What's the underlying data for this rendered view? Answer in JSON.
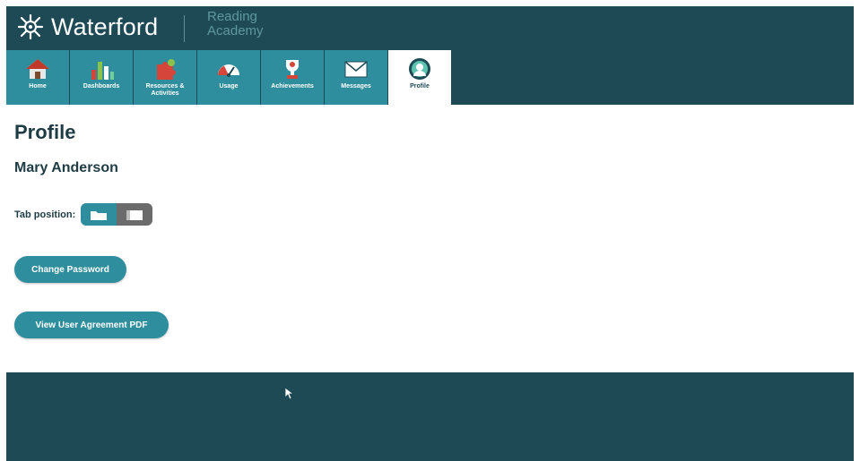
{
  "header": {
    "brand": "Waterford",
    "product_line1": "Reading",
    "product_line2": "Academy"
  },
  "nav": {
    "tabs": [
      {
        "label": "Home",
        "icon": "house-icon"
      },
      {
        "label": "Dashboards",
        "icon": "bar-chart-icon"
      },
      {
        "label": "Resources & Activities",
        "icon": "puzzle-icon"
      },
      {
        "label": "Usage",
        "icon": "gauge-icon"
      },
      {
        "label": "Achievements",
        "icon": "trophy-icon"
      },
      {
        "label": "Messages",
        "icon": "envelope-icon"
      },
      {
        "label": "Profile",
        "icon": "profile-avatar-icon",
        "active": true
      }
    ]
  },
  "page": {
    "title": "Profile",
    "user_name": "Mary Anderson",
    "tab_position_label": "Tab position:",
    "change_password_label": "Change Password",
    "view_agreement_label": "View User Agreement PDF"
  },
  "colors": {
    "header_bg": "#1e4a55",
    "accent": "#2f8e9e",
    "text": "#1e3c44"
  }
}
